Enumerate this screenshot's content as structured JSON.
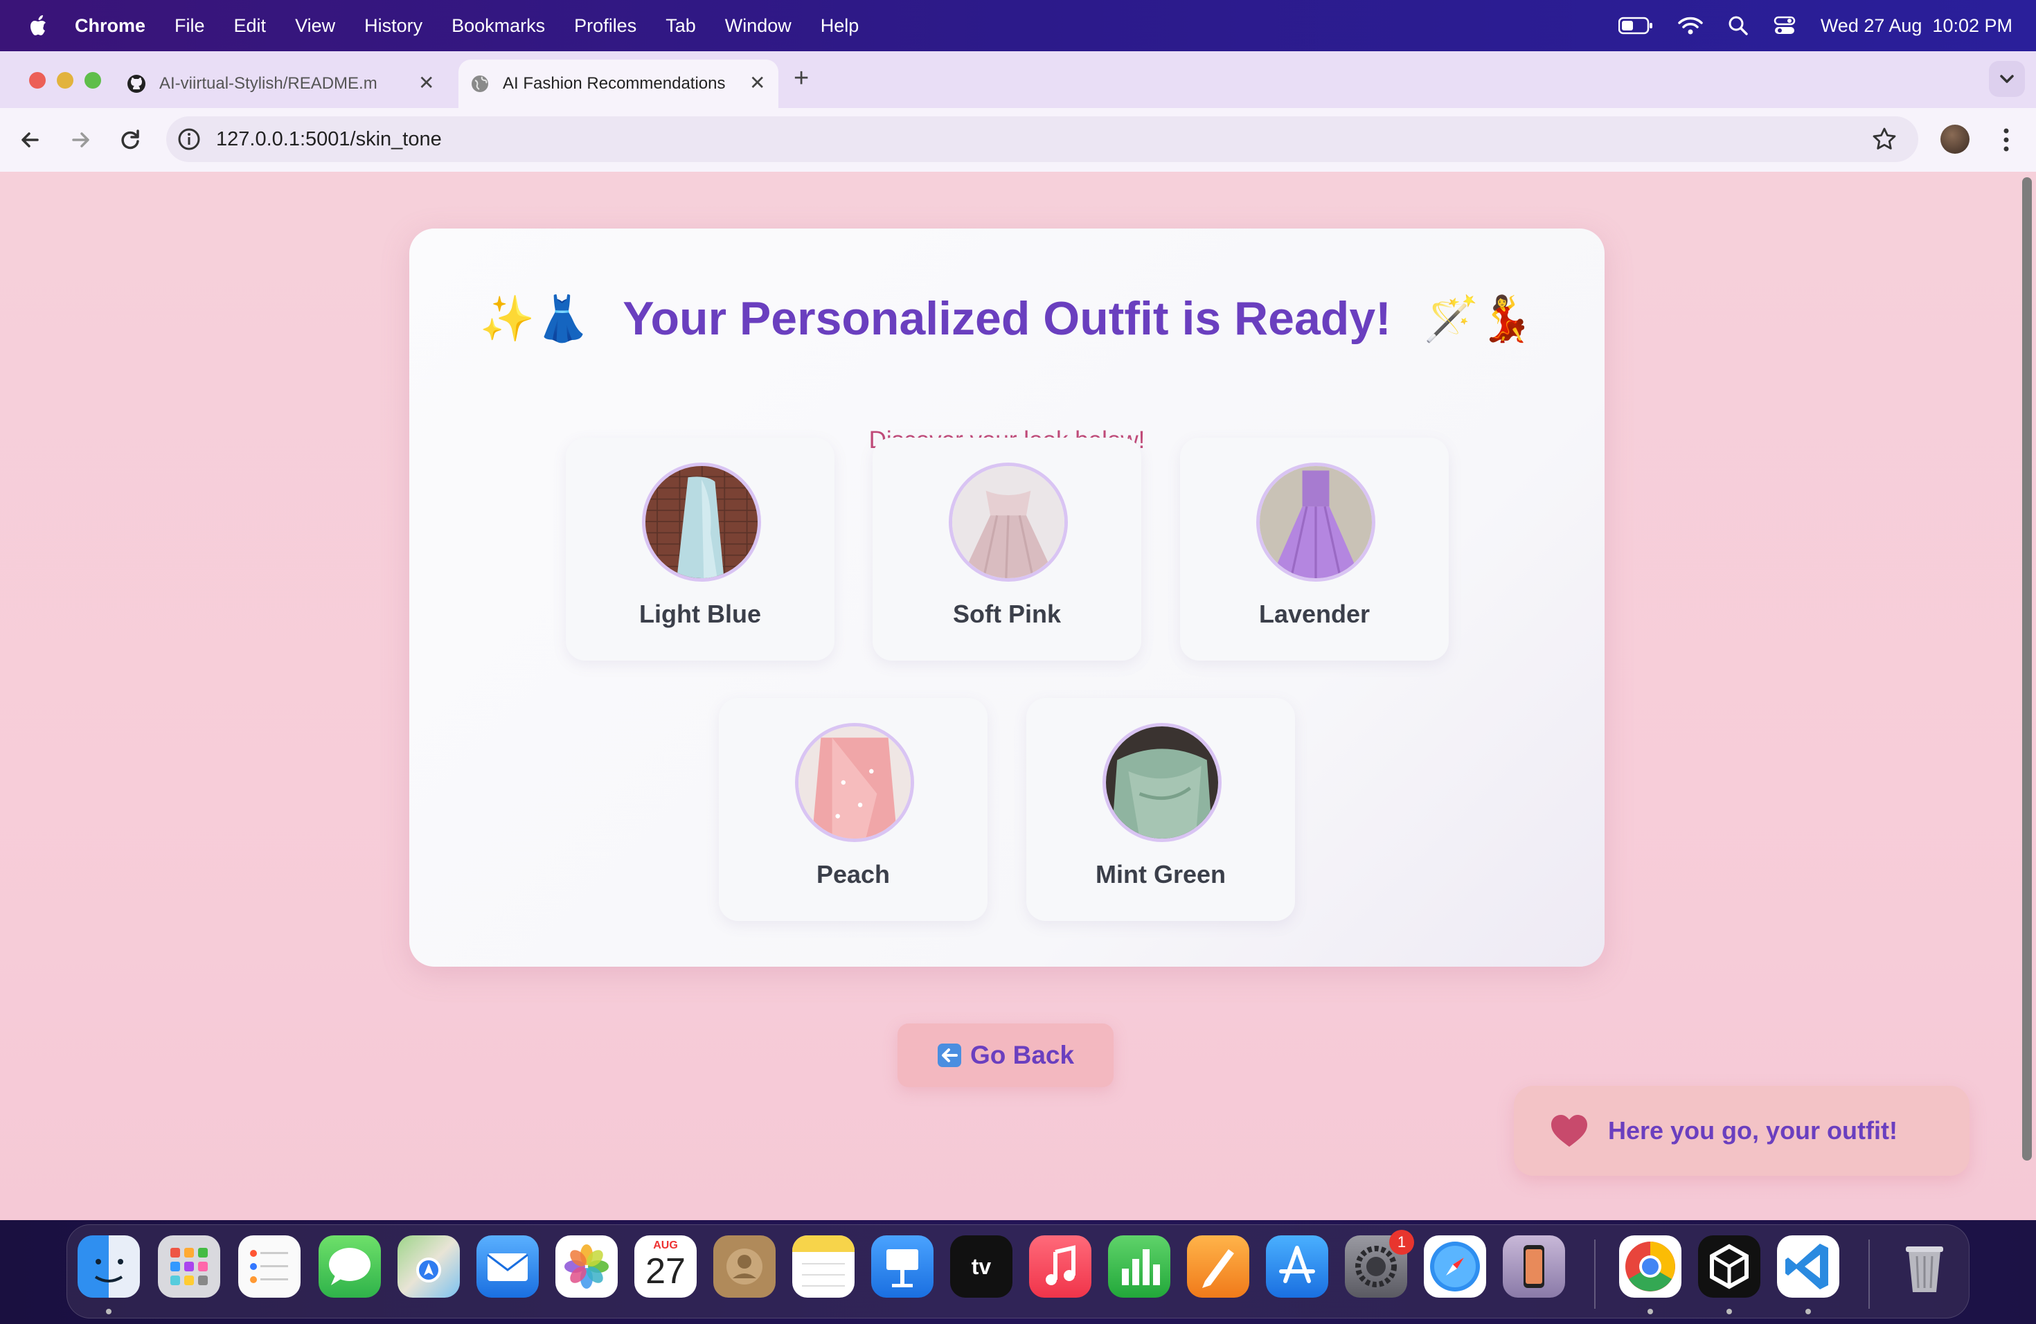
{
  "menubar": {
    "app": "Chrome",
    "items": [
      "File",
      "Edit",
      "View",
      "History",
      "Bookmarks",
      "Profiles",
      "Tab",
      "Window",
      "Help"
    ],
    "datetime": "Wed 27 Aug  10:02 PM"
  },
  "browser": {
    "tabs": [
      {
        "title": "AI-viirtual-Stylish/README.m",
        "icon": "github-icon"
      },
      {
        "title": "AI Fashion Recommendations",
        "icon": "globe-icon"
      }
    ],
    "url": "127.0.0.1:5001/skin_tone"
  },
  "page": {
    "title": "Your Personalized Outfit is Ready!",
    "title_emoji_left": "✨👗",
    "title_emoji_right": "🪄💃",
    "subtitle": "Discover your look below!",
    "outfits": [
      {
        "label": "Light Blue"
      },
      {
        "label": "Soft Pink"
      },
      {
        "label": "Lavender"
      },
      {
        "label": "Peach"
      },
      {
        "label": "Mint Green"
      }
    ],
    "go_back": "Go Back",
    "toast": "Here you go, your outfit!"
  },
  "dock": {
    "calendar_month": "AUG",
    "calendar_day": "27",
    "settings_badge": "1",
    "apps": [
      "Finder",
      "Launchpad",
      "Reminders",
      "Messages",
      "Maps",
      "Mail",
      "Photos",
      "Calendar",
      "Contacts",
      "Notes",
      "Keynote",
      "TV",
      "Music",
      "Numbers",
      "Pages",
      "App Store",
      "System Settings",
      "Safari",
      "iPhone Mirroring",
      "Chrome",
      "Unity",
      "Visual Studio Code",
      "Trash"
    ]
  },
  "colors": {
    "accent_purple": "#6a3fbf",
    "subtitle_pink": "#c04a78",
    "page_bg": "#f6d0da"
  }
}
